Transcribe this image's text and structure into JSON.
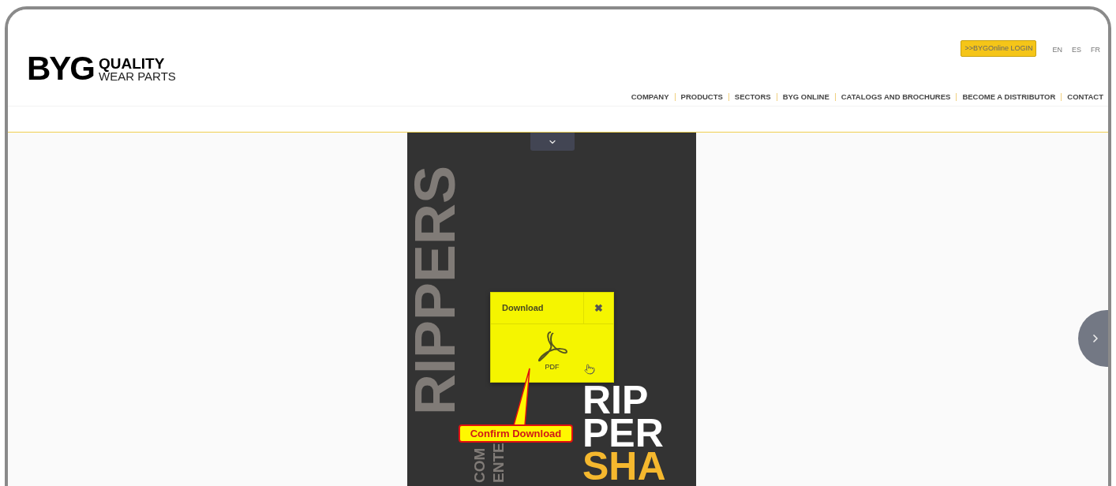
{
  "logo": {
    "mark": "BYG",
    "line1": "QUALITY",
    "line2": "WEAR PARTS"
  },
  "login_button": ">>BYGOnline LOGIN",
  "languages": [
    "EN",
    "ES",
    "FR"
  ],
  "nav": [
    "COMPANY",
    "PRODUCTS",
    "SECTORS",
    "BYG ONLINE",
    "CATALOGS AND BROCHURES",
    "BECOME A DISTRIBUTOR",
    "CONTACT"
  ],
  "catalog": {
    "side_texts": [
      {
        "text": "RIPPERS",
        "kind": "large"
      },
      {
        "text": "COM",
        "kind": "small"
      },
      {
        "text": "ENTE",
        "kind": "small"
      }
    ],
    "headline": [
      {
        "text": "RIP",
        "color": "#ffffff"
      },
      {
        "text": "PER",
        "color": "#ffffff"
      },
      {
        "text": "SHA",
        "color": "#f5b82e"
      }
    ]
  },
  "page_toggle": {
    "expanded": true
  },
  "download_popup": {
    "title": "Download",
    "close": "✖",
    "format": "PDF"
  },
  "callout": "Confirm Download"
}
